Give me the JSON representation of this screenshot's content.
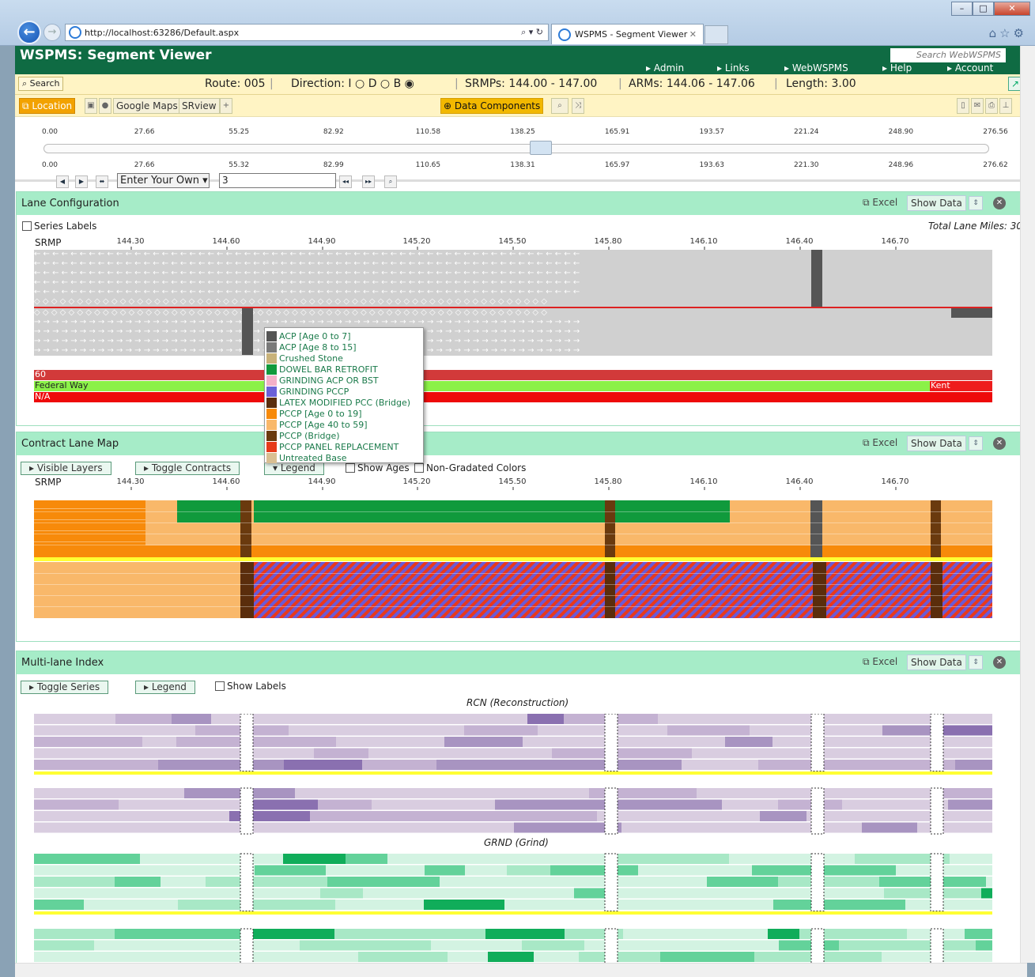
{
  "browser": {
    "url": "http://localhost:63286/Default.aspx",
    "tab_title": "WSPMS - Segment Viewer",
    "window_controls": [
      "minimize-icon",
      "maximize-icon",
      "close-icon"
    ],
    "address_controls": "⌕ ▾ ↻"
  },
  "header": {
    "title": "WSPMS: Segment Viewer",
    "search_placeholder": "Search WebWSPMS",
    "nav": [
      "Admin",
      "Links",
      "WebWSPMS",
      "Help",
      "Account"
    ]
  },
  "route_bar": {
    "search_label": "Search",
    "route": "Route: 005",
    "direction_label": "Direction:",
    "direction_options": [
      "I",
      "D",
      "B"
    ],
    "direction_selected": "B",
    "srmps": "SRMPs: 144.00 - 147.00",
    "arms": "ARMs: 144.06 - 147.06",
    "length": "Length: 3.00"
  },
  "toolbar": {
    "location": "Location",
    "google_maps": "Google Maps",
    "srview": "SRview",
    "data_components": "Data Components"
  },
  "slider": {
    "top_ticks": [
      "0.00",
      "27.66",
      "55.25",
      "82.92",
      "110.58",
      "138.25",
      "165.91",
      "193.57",
      "221.24",
      "248.90",
      "276.56"
    ],
    "bottom_ticks": [
      "0.00",
      "27.66",
      "55.32",
      "82.99",
      "110.65",
      "138.31",
      "165.97",
      "193.63",
      "221.30",
      "248.96",
      "276.62"
    ],
    "range_select": "Enter Your Own",
    "range_value": "3"
  },
  "lane_config": {
    "title": "Lane Configuration",
    "excel": "Excel",
    "show_data": "Show Data",
    "series_labels": "Series Labels",
    "total_lane_miles": "Total Lane Miles: 30",
    "srmp_label": "SRMP",
    "milepost_ticks": [
      "144.30",
      "144.60",
      "144.90",
      "145.20",
      "145.50",
      "145.80",
      "146.10",
      "146.40",
      "146.70"
    ],
    "band_speed": "60",
    "band_city_1": "Federal Way",
    "band_city_2": "Kent",
    "band_na": "N/A"
  },
  "legend_popup": [
    {
      "label": "ACP [Age 0 to 7]",
      "color": "#555555"
    },
    {
      "label": "ACP [Age 8 to 15]",
      "color": "#7a7a7a"
    },
    {
      "label": "Crushed Stone",
      "color": "#c8b27a"
    },
    {
      "label": "DOWEL BAR RETROFIT",
      "color": "#109a3c"
    },
    {
      "label": "GRINDING ACP OR BST",
      "color": "#f4b0c8"
    },
    {
      "label": "GRINDING PCCP",
      "color": "#6a60d8"
    },
    {
      "label": "LATEX MODIFIED PCC (Bridge)",
      "color": "#5a2d0c"
    },
    {
      "label": "PCCP [Age 0 to 19]",
      "color": "#f78a0a"
    },
    {
      "label": "PCCP [Age 40 to 59]",
      "color": "#f9b86a"
    },
    {
      "label": "PCCP (Bridge)",
      "color": "#6a3a0e"
    },
    {
      "label": "PCCP PANEL REPLACEMENT",
      "color": "#e63a1a"
    },
    {
      "label": "Untreated Base",
      "color": "#d9bf92"
    }
  ],
  "contract_map": {
    "title": "Contract Lane Map",
    "excel": "Excel",
    "show_data": "Show Data",
    "visible_layers": "Visible Layers",
    "toggle_contracts": "Toggle Contracts",
    "legend": "Legend",
    "show_ages": "Show Ages",
    "non_graded": "Non-Gradated Colors",
    "srmp_label": "SRMP"
  },
  "multilane": {
    "title": "Multi-lane Index",
    "excel": "Excel",
    "show_data": "Show Data",
    "toggle_series": "Toggle Series",
    "legend": "Legend",
    "show_labels": "Show Labels",
    "rcn_title": "RCN (Reconstruction)",
    "grnd_title": "GRND (Grind)"
  }
}
